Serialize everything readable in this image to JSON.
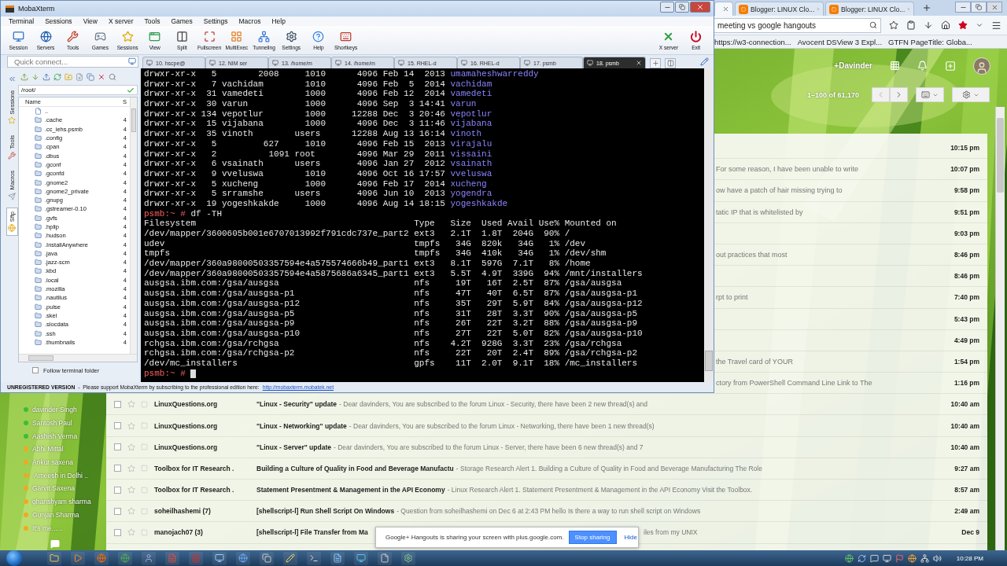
{
  "moba": {
    "title": "MobaXterm",
    "menu": [
      "Terminal",
      "Sessions",
      "View",
      "X server",
      "Tools",
      "Games",
      "Settings",
      "Macros",
      "Help"
    ],
    "toolbar": [
      "Session",
      "Servers",
      "Tools",
      "Games",
      "Sessions",
      "View",
      "Split",
      "Fullscreen",
      "MultiExec",
      "Tunneling",
      "Settings",
      "Help",
      "Shortkeys"
    ],
    "toolbar_right": [
      "X server",
      "Exit"
    ],
    "quick_connect": {
      "placeholder": "Quick connect..."
    },
    "tabs": [
      {
        "label": "10. hscpe@",
        "selected": false
      },
      {
        "label": "12. NIM ser",
        "selected": false
      },
      {
        "label": "13. /home/m",
        "selected": false
      },
      {
        "label": "14. /home/m",
        "selected": false
      },
      {
        "label": "15. RHEL-d",
        "selected": false
      },
      {
        "label": "16. RHEL-d",
        "selected": false
      },
      {
        "label": "17. psmb",
        "selected": false
      },
      {
        "label": "18. psmb",
        "selected": true
      }
    ],
    "side_tabs": [
      {
        "label": "Sessions",
        "selected": false
      },
      {
        "label": "Tools",
        "selected": false
      },
      {
        "label": "Macros",
        "selected": false
      },
      {
        "label": "Sftp",
        "selected": true
      }
    ],
    "sftp": {
      "path": "/root/",
      "columns": [
        "Name",
        "S"
      ],
      "files": [
        {
          "name": ".."
        },
        {
          "name": ".cache",
          "size": "4"
        },
        {
          "name": ".cc_iehs.psmb",
          "size": "4"
        },
        {
          "name": ".config",
          "size": "4"
        },
        {
          "name": ".cpan",
          "size": "4"
        },
        {
          "name": ".dbus",
          "size": "4"
        },
        {
          "name": ".gconf",
          "size": "4"
        },
        {
          "name": ".gconfd",
          "size": "4"
        },
        {
          "name": ".gnome2",
          "size": "4"
        },
        {
          "name": ".gnome2_private",
          "size": "4"
        },
        {
          "name": ".gnupg",
          "size": "4"
        },
        {
          "name": ".gstreamer-0.10",
          "size": "4"
        },
        {
          "name": ".gvfs",
          "size": "4"
        },
        {
          "name": ".hplip",
          "size": "4"
        },
        {
          "name": ".hudson",
          "size": "4"
        },
        {
          "name": ".InstallAnywhere",
          "size": "4"
        },
        {
          "name": ".java",
          "size": "4"
        },
        {
          "name": ".jazz-scm",
          "size": "4"
        },
        {
          "name": ".kbd",
          "size": "4"
        },
        {
          "name": ".local",
          "size": "4"
        },
        {
          "name": ".mozilla",
          "size": "4"
        },
        {
          "name": ".nautilus",
          "size": "4"
        },
        {
          "name": ".pulse",
          "size": "4"
        },
        {
          "name": ".skel",
          "size": "4"
        },
        {
          "name": ".slocdata",
          "size": "4"
        },
        {
          "name": ".ssh",
          "size": "4"
        },
        {
          "name": ".thumbnails",
          "size": "4"
        }
      ],
      "follow": {
        "label": "Follow terminal folder",
        "checked": false
      }
    },
    "terminal": {
      "listing": [
        {
          "text": "drwxr-xr-x   5        2008     1010      4096 Feb 14  2013",
          "name": "umamaheshwarreddy"
        },
        {
          "text": "drwxr-xr-x   7 vachidam        1010      4096 Feb  5  2014",
          "name": "vachidam"
        },
        {
          "text": "drwxr-xr-x  31 vamedeti        1000      4096 Feb 12  2014",
          "name": "vamedeti"
        },
        {
          "text": "drwxr-xr-x  30 varun           1000      4096 Sep  3 14:41",
          "name": "varun"
        },
        {
          "text": "drwxr-xr-x 134 vepotlur        1000     12288 Dec  3 20:46",
          "name": "vepotlur"
        },
        {
          "text": "drwxr-xr-x  15 vijabana        1000      4096 Dec  3 11:46",
          "name": "vijabana"
        },
        {
          "text": "drwxr-xr-x  35 vinoth        users      12288 Aug 13 16:14",
          "name": "vinoth"
        },
        {
          "text": "drwxr-xr-x   5         627     1010      4096 Feb 15  2013",
          "name": "virajalu"
        },
        {
          "text": "drwxr-xr-x   2          1091 root        4096 Mar 29  2011",
          "name": "vissaini"
        },
        {
          "text": "drwxr-xr-x   6 vsainath      users       4096 Jan 27  2012",
          "name": "vsainath"
        },
        {
          "text": "drwxr-xr-x   9 vveluswa        1010      4096 Oct 16 17:57",
          "name": "vveluswa"
        },
        {
          "text": "drwxr-xr-x   5 xucheng         1000      4096 Feb 17  2014",
          "name": "xucheng"
        },
        {
          "text": "drwxr-xr-x   5 srramshe      users       4096 Jun 10  2013",
          "name": "yogendra"
        },
        {
          "text": "drwxr-xr-x  19 yogeshkakde     1000      4096 Aug 14 18:15",
          "name": "yogeshkakde"
        }
      ],
      "command": {
        "prompt": "psmb:~ #",
        "command": "df -TH"
      },
      "df": {
        "columns": [
          "Filesystem",
          "Type",
          "Size",
          "Used",
          "Avail",
          "Use%",
          "Mounted on"
        ],
        "rows": [
          [
            "/dev/mapper/3600605b001e6707013992f791cdc737e_part2",
            "ext3",
            "2.1T",
            "1.8T",
            "204G",
            "90%",
            "/"
          ],
          [
            "udev",
            "tmpfs",
            "34G",
            "820k",
            "34G",
            "1%",
            "/dev"
          ],
          [
            "tmpfs",
            "tmpfs",
            "34G",
            "410k",
            "34G",
            "1%",
            "/dev/shm"
          ],
          [
            "/dev/mapper/360a98000503357594e4a575574666b49_part1",
            "ext3",
            "8.1T",
            "597G",
            "7.1T",
            "8%",
            "/home"
          ],
          [
            "/dev/mapper/360a98000503357594e4a5875686a6345_part1",
            "ext3",
            "5.5T",
            "4.9T",
            "339G",
            "94%",
            "/mnt/installers"
          ],
          [
            "ausgsa.ibm.com:/gsa/ausgsa",
            "nfs",
            "19T",
            "16T",
            "2.5T",
            "87%",
            "/gsa/ausgsa"
          ],
          [
            "ausgsa.ibm.com:/gsa/ausgsa-p1",
            "nfs",
            "47T",
            "40T",
            "6.5T",
            "87%",
            "/gsa/ausgsa-p1"
          ],
          [
            "ausgsa.ibm.com:/gsa/ausgsa-p12",
            "nfs",
            "35T",
            "29T",
            "5.9T",
            "84%",
            "/gsa/ausgsa-p12"
          ],
          [
            "ausgsa.ibm.com:/gsa/ausgsa-p5",
            "nfs",
            "31T",
            "28T",
            "3.3T",
            "90%",
            "/gsa/ausgsa-p5"
          ],
          [
            "ausgsa.ibm.com:/gsa/ausgsa-p9",
            "nfs",
            "26T",
            "22T",
            "3.2T",
            "88%",
            "/gsa/ausgsa-p9"
          ],
          [
            "ausgsa.ibm.com:/gsa/ausgsa-p10",
            "nfs",
            "27T",
            "22T",
            "5.0T",
            "82%",
            "/gsa/ausgsa-p10"
          ],
          [
            "rchgsa.ibm.com:/gsa/rchgsa",
            "nfs",
            "4.2T",
            "928G",
            "3.3T",
            "23%",
            "/gsa/rchgsa"
          ],
          [
            "rchgsa.ibm.com:/gsa/rchgsa-p2",
            "nfs",
            "22T",
            "20T",
            "2.4T",
            "89%",
            "/gsa/rchgsa-p2"
          ],
          [
            "/dev/mc_installers",
            "gpfs",
            "11T",
            "2.0T",
            "9.1T",
            "18%",
            "/mc_installers"
          ]
        ]
      },
      "final_prompt": {
        "prompt": "psmb:~ #"
      }
    },
    "status": {
      "notice": "**UNREGISTERED VERSION**  -  Please support MobaXterm by subscribing to the professional edition here:",
      "link": "http://mobaxterm.mobatek.net"
    }
  },
  "browser": {
    "tabs": [
      {
        "kind": "partial",
        "selected": true
      },
      {
        "kind": "full",
        "label": "Blogger: LINUX Clo...",
        "selected": false
      },
      {
        "kind": "full",
        "label": "Blogger: LINUX Clo...",
        "selected": false
      }
    ],
    "address": "meeting vs google hangouts",
    "bookmarks": [
      "https://w3-connection...",
      "Avocent DSView 3 Expl...",
      "GTFN PageTitle: Globa..."
    ],
    "gmail": {
      "account": "+Davinder",
      "pagination": "1–100 of 61,170",
      "emails": [
        {
          "kind": "partial",
          "time": "10:15 pm"
        },
        {
          "kind": "partial",
          "snippet": "For some reason, I have been unable to write",
          "time": "10:07 pm"
        },
        {
          "kind": "partial",
          "snippet": "ow have a patch of hair missing trying to",
          "time": "9:58 pm"
        },
        {
          "kind": "partial",
          "snippet": "tatic IP that is whitelisted by",
          "time": "9:51 pm"
        },
        {
          "kind": "partial",
          "time": "9:03 pm"
        },
        {
          "kind": "partial",
          "snippet": "out practices that most",
          "time": "8:46 pm"
        },
        {
          "kind": "partial",
          "time": "8:46 pm"
        },
        {
          "kind": "partial",
          "snippet": "rpt to print",
          "time": "7:40 pm"
        },
        {
          "kind": "partial",
          "time": "5:43 pm"
        },
        {
          "kind": "partial",
          "time": "4:49 pm"
        },
        {
          "kind": "partial",
          "snippet": "the Travel card of YOUR",
          "time": "1:54 pm"
        },
        {
          "kind": "partial",
          "snippet": "ctory from PowerShell Command Line Link to The",
          "time": "1:16 pm"
        },
        {
          "kind": "full",
          "checked": false,
          "starred": false,
          "sender": "LinuxQuestions.org",
          "subject": "\"Linux - Security\" update",
          "snippet": "- Dear davinders, You are subscribed to the forum Linux - Security, there have been 2 new thread(s) and",
          "time": "10:40 am"
        },
        {
          "kind": "full",
          "checked": false,
          "starred": false,
          "sender": "LinuxQuestions.org",
          "subject": "\"Linux - Networking\" update",
          "snippet": "- Dear davinders, You are subscribed to the forum Linux - Networking, there have been 1 new thread(s)",
          "time": "10:40 am"
        },
        {
          "kind": "full",
          "checked": false,
          "starred": false,
          "sender": "LinuxQuestions.org",
          "subject": "\"Linux - Server\" update",
          "snippet": "- Dear davinders, You are subscribed to the forum Linux - Server, there have been 6 new thread(s) and 7",
          "time": "10:40 am"
        },
        {
          "kind": "full",
          "checked": false,
          "starred": false,
          "sender": "Toolbox for IT Research .",
          "subject": "Building a Culture of Quality in Food and Beverage Manufactu",
          "snippet": "- Storage Research Alert 1. Building a Culture of Quality in Food and Beverage Manufacturing The Role",
          "time": "9:27 am"
        },
        {
          "kind": "full",
          "checked": false,
          "starred": false,
          "sender": "Toolbox for IT Research .",
          "subject": "Statement Presentment & Management in the API Economy",
          "snippet": "- Linux Research Alert 1. Statement Presentment & Management in the API Economy Visit the Toolbox.",
          "time": "8:57 am"
        },
        {
          "kind": "full",
          "checked": false,
          "starred": false,
          "sender": "soheilhashemi (7)",
          "subject": "[shellscript-l] Run Shell Script On Windows",
          "snippet": "- Question from soheilhashemi on Dec 6 at 2:43 PM hello Is there a way to run shell script on Windows",
          "time": "2:49 am"
        },
        {
          "kind": "covered",
          "checked": false,
          "starred": false,
          "sender": "manojach07 (3)",
          "subject": "[shellscript-l] File Transfer from Ma",
          "tail": "iles from my UNIX",
          "time": "Dec 9"
        }
      ],
      "chat": [
        {
          "kind": "dot",
          "name": "davinder Singh",
          "color": "#3dbb3d"
        },
        {
          "kind": "dot",
          "name": "Santosh Paul",
          "color": "#3dbb3d"
        },
        {
          "kind": "dot",
          "name": "Aashish Verma",
          "color": "#3dbb3d"
        },
        {
          "kind": "dot",
          "name": "Abhi Mittal",
          "color": "#f5a623"
        },
        {
          "kind": "dot",
          "name": "Ankur saxena",
          "color": "#f5a623"
        },
        {
          "kind": "video",
          "name": "Ameesh in Delhi ..",
          "color": "#f5a623"
        },
        {
          "kind": "dot",
          "name": "Garvit Saxena",
          "color": "#f5a623"
        },
        {
          "kind": "dot",
          "name": "ghanshyam sharma",
          "color": "#f5a623"
        },
        {
          "kind": "dot",
          "name": "Gunjan Sharma",
          "color": "#f5a623"
        },
        {
          "kind": "dot",
          "name": "It's me......",
          "color": "#f5a623"
        }
      ]
    },
    "hangouts": {
      "message": "Google+ Hangouts is sharing your screen with plus.google.com.",
      "stop": "Stop sharing",
      "hide": "Hide"
    }
  },
  "taskbar": {
    "clock": "10:28 PM"
  }
}
